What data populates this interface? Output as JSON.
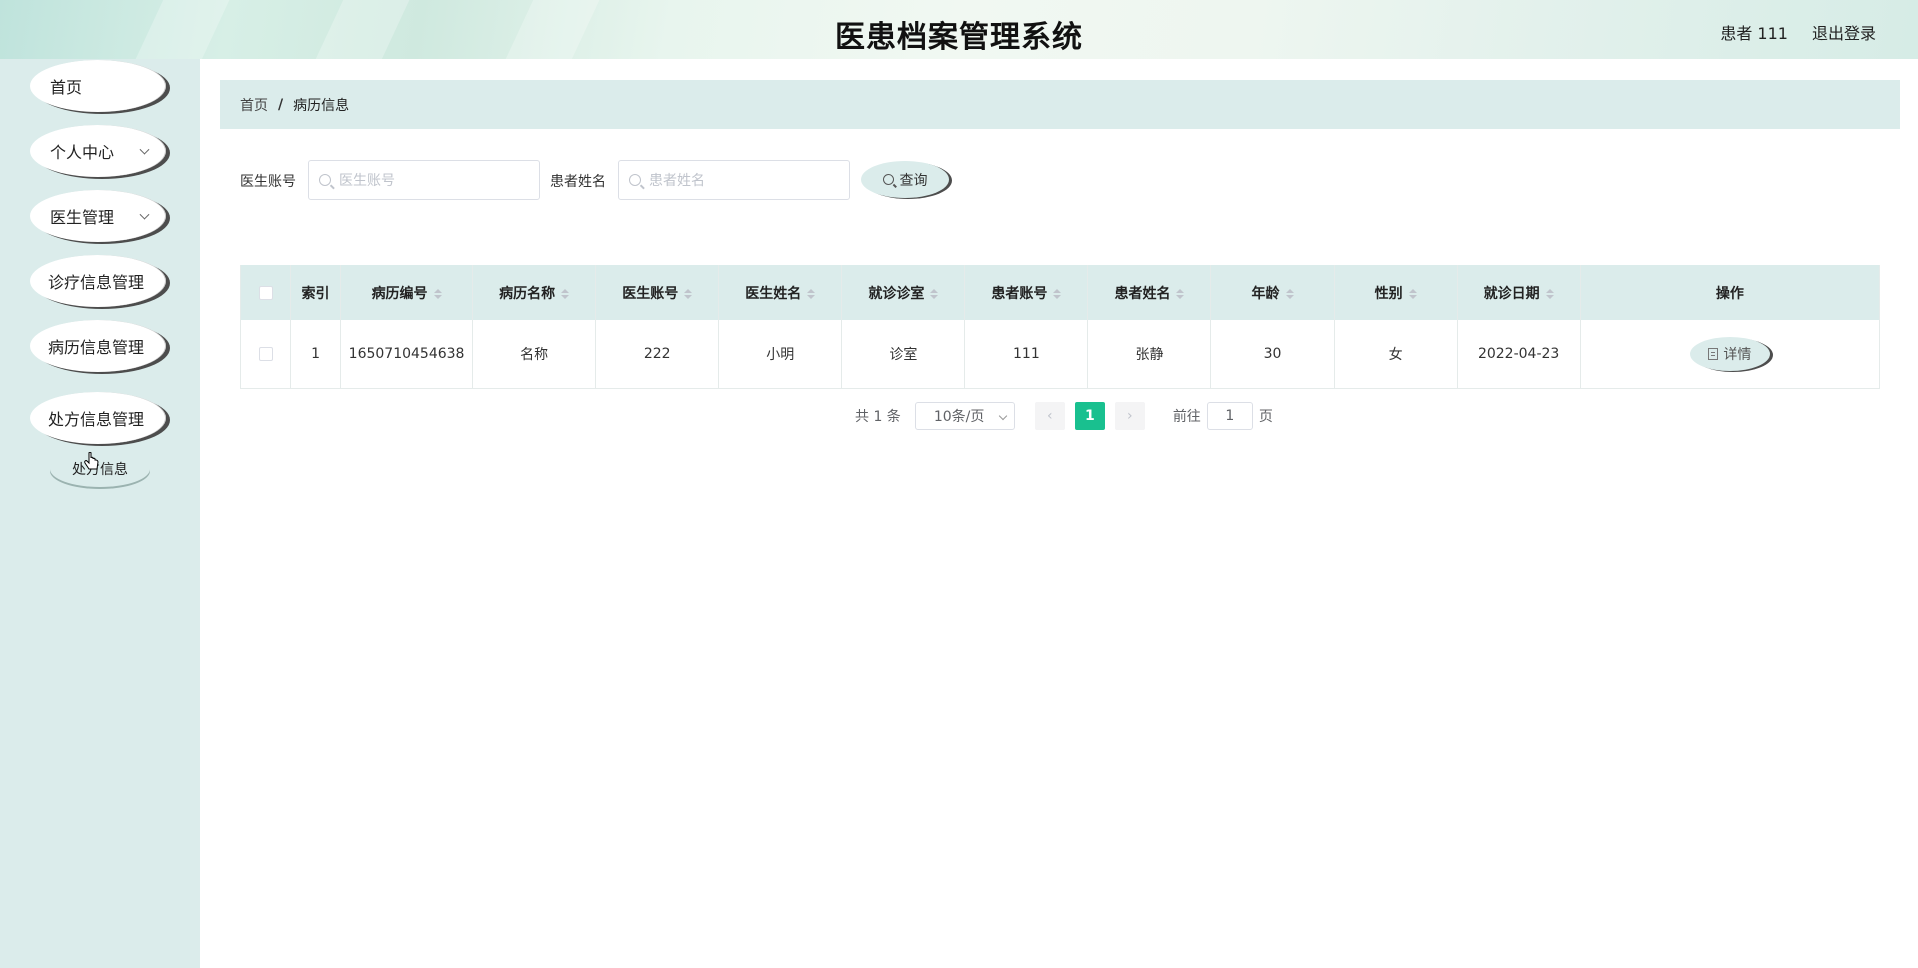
{
  "header": {
    "title": "医患档案管理系统",
    "user": "患者 111",
    "logout": "退出登录"
  },
  "sidebar": {
    "items": [
      {
        "label": "首页"
      },
      {
        "label": "个人中心"
      },
      {
        "label": "医生管理"
      },
      {
        "label": "诊疗信息管理"
      },
      {
        "label": "病历信息管理"
      },
      {
        "label": "处方信息管理"
      }
    ],
    "submenu": {
      "label": "处方信息"
    }
  },
  "breadcrumb": {
    "home": "首页",
    "separator": "/",
    "current": "病历信息"
  },
  "search": {
    "doctor_label": "医生账号",
    "doctor_placeholder": "医生账号",
    "patient_label": "患者姓名",
    "patient_placeholder": "患者姓名",
    "query_label": "查询"
  },
  "table": {
    "headers": [
      "索引",
      "病历编号",
      "病历名称",
      "医生账号",
      "医生姓名",
      "就诊诊室",
      "患者账号",
      "患者姓名",
      "年龄",
      "性别",
      "就诊日期",
      "操作"
    ],
    "rows": [
      {
        "index": "1",
        "record_no": "1650710454638",
        "record_name": "名称",
        "doctor_account": "222",
        "doctor_name": "小明",
        "clinic": "诊室",
        "patient_account": "111",
        "patient_name": "张静",
        "age": "30",
        "gender": "女",
        "date": "2022-04-23",
        "action": "详情"
      }
    ]
  },
  "pagination": {
    "total": "共 1 条",
    "page_size": "10条/页",
    "current_page": "1",
    "goto_label": "前往",
    "goto_value": "1",
    "page_suffix": "页"
  },
  "colors": {
    "accent": "#19c08f",
    "panel": "#dbeceb"
  }
}
